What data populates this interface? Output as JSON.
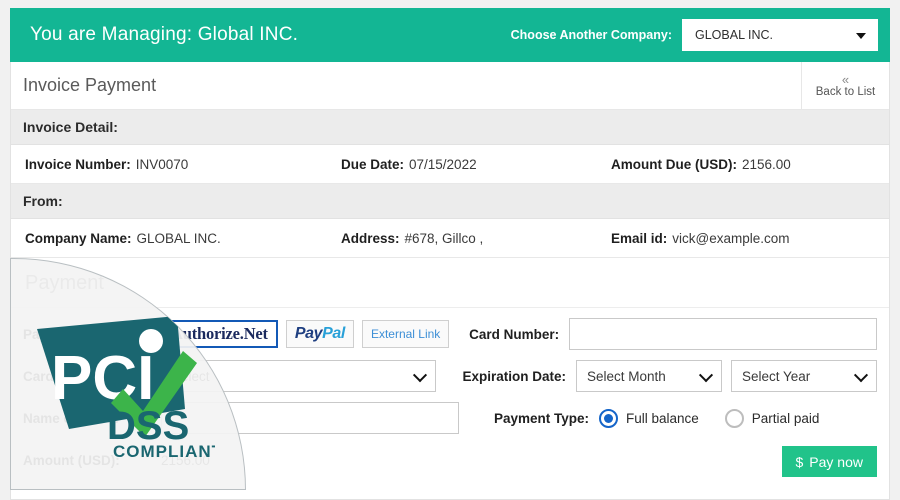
{
  "topbar": {
    "managing_text": "You are Managing: Global INC.",
    "choose_label": "Choose Another Company:",
    "selected_company": "GLOBAL INC.",
    "bg_color": "#13b694"
  },
  "card": {
    "page_title": "Invoice Payment",
    "back_to_list": {
      "chevron": "«",
      "label": "Back to List"
    }
  },
  "invoice_detail": {
    "heading": "Invoice Detail:",
    "fields": [
      {
        "key": "Invoice Number:",
        "value": "INV0070"
      },
      {
        "key": "Due Date:",
        "value": "07/15/2022"
      },
      {
        "key": "Amount Due (USD):",
        "value": "2156.00"
      }
    ]
  },
  "from": {
    "heading": "From:",
    "fields": [
      {
        "key": "Company Name:",
        "value": "GLOBAL INC."
      },
      {
        "key": "Address:",
        "value": "#678, Gillco ,"
      },
      {
        "key": "Email id:",
        "value": "vick@example.com"
      }
    ]
  },
  "payment": {
    "title": "Payment",
    "method_label": "Payment method:",
    "methods": [
      {
        "name": "authorize-net",
        "label": "Authorize.Net",
        "selected": true
      },
      {
        "name": "paypal",
        "label": "PayPal",
        "label_part1": "Pay",
        "label_part2": "Pal",
        "selected": false
      },
      {
        "name": "external-link",
        "label": "External Link",
        "selected": false
      }
    ],
    "card_type_label": "Card Type:",
    "card_type_value": "Select",
    "name_on_card_label": "Name on Card:",
    "name_on_card_value": "",
    "amount_label": "Amount (USD):",
    "amount_value": "2156.00",
    "card_number_label": "Card Number:",
    "card_number_value": "",
    "expiration_label": "Expiration Date:",
    "expiration_month": "Select Month",
    "expiration_year": "Select Year",
    "payment_type_label": "Payment Type:",
    "payment_types": [
      {
        "label": "Full balance",
        "selected": true
      },
      {
        "label": "Partial paid",
        "selected": false
      }
    ],
    "pay_now": {
      "currency_symbol": "$",
      "label": "Pay now",
      "color": "#21c38a"
    }
  },
  "overlay": {
    "badge_name": "pci-dss-compliant-badge",
    "brand_text": "PCI",
    "standard_text": "DSS",
    "compliant_text": "COMPLIANT",
    "teal": "#1a6670",
    "green": "#3cb44a"
  }
}
